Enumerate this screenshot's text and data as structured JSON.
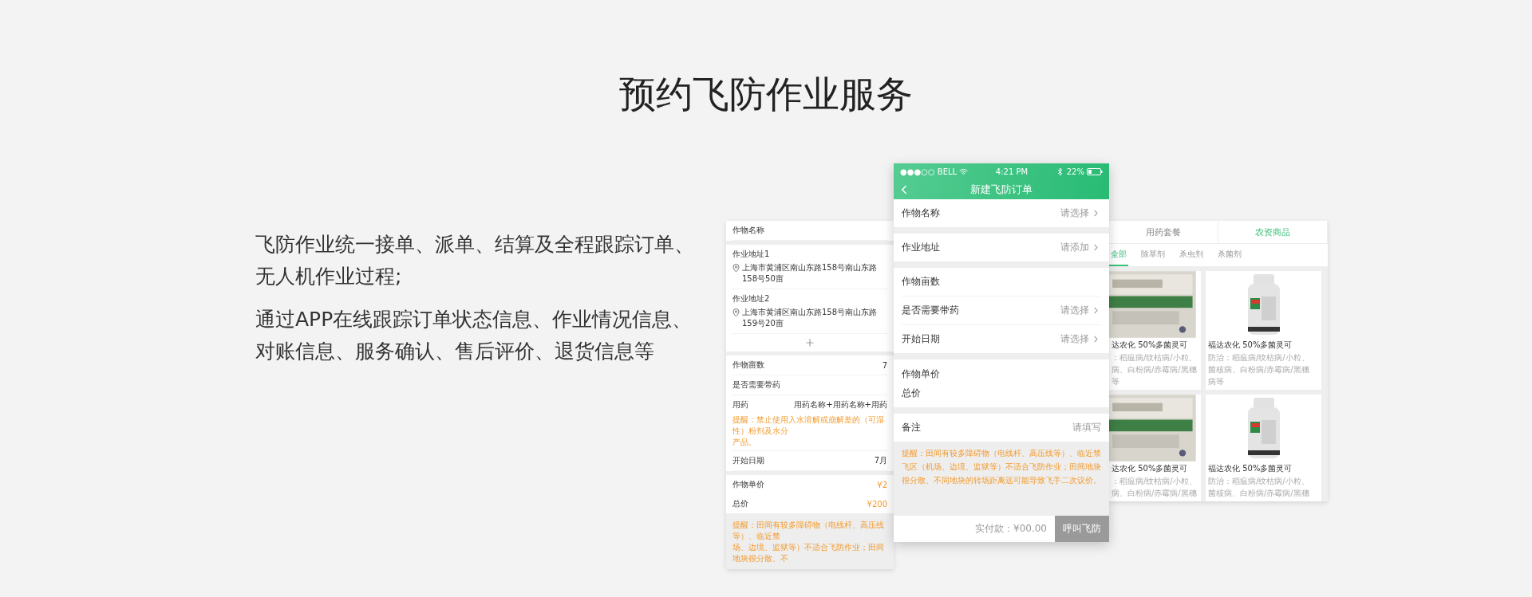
{
  "title": "预约飞防作业服务",
  "intro": [
    "飞防作业统一接单、派单、结算及全程跟踪订单、无人机作业过程;",
    "通过APP在线跟踪订单状态信息、作业情况信息、对账信息、服务确认、售后评价、退货信息等"
  ],
  "order_card": {
    "crop_label": "作物名称",
    "addresses": [
      {
        "label": "作业地址1",
        "address": "上海市黄浦区南山东路158号南山东路158号50亩"
      },
      {
        "label": "作业地址2",
        "address": "上海市黄浦区南山东路158号南山东路159号20亩"
      }
    ],
    "rows": [
      {
        "kind": "value",
        "label": "作物亩数",
        "value": "7"
      },
      {
        "kind": "value",
        "label": "是否需要带药"
      },
      {
        "kind": "drug",
        "label": "用药",
        "value": "用药名称+用药名称+用药",
        "note_lines": [
          "提醒：禁止使用入水溶解或崩解差的（可湿性）粉剂及水分",
          "产品。"
        ]
      },
      {
        "kind": "value",
        "label": "开始日期",
        "value": "7月"
      }
    ],
    "prices": [
      {
        "label": "作物单价",
        "value": "¥2"
      },
      {
        "label": "总价",
        "value": "¥200"
      }
    ],
    "note_lines": [
      "提醒：田间有较多障碍物（电线杆、高压线等）、临近禁",
      "场、边境、监狱等）不适合飞防作业；田间地块很分散、不"
    ]
  },
  "phone": {
    "status_bar": {
      "carrier": "●●●○○ BELL",
      "time": "4:21 PM",
      "battery": "22%"
    },
    "nav_title": "新建飞防订单",
    "groups": [
      [
        {
          "kind": "select",
          "label": "作物名称",
          "action": "请选择"
        }
      ],
      [
        {
          "kind": "select",
          "label": "作业地址",
          "action": "请添加"
        }
      ],
      [
        {
          "kind": "plain",
          "label": "作物亩数"
        },
        {
          "kind": "select",
          "label": "是否需要带药",
          "action": "请选择"
        },
        {
          "kind": "select",
          "label": "开始日期",
          "action": "请选择"
        }
      ],
      [
        {
          "kind": "compact",
          "label": "作物单价"
        },
        {
          "kind": "compact",
          "label": "总价"
        }
      ],
      [
        {
          "kind": "input",
          "label": "备注",
          "action": "请填写"
        }
      ]
    ],
    "note": "提醒：田间有较多障碍物（电线杆、高压线等）、临近禁飞区（机场、边境、监狱等）不适合飞防作业；田间地块很分散、不同地块的转场距离远可能导致飞手二次议价。",
    "total": "实付款：¥00.00",
    "call_button": "呼叫飞防"
  },
  "shop_card": {
    "tabs": [
      {
        "label": "用药套餐",
        "selected": false
      },
      {
        "label": "农资商品",
        "selected": true
      }
    ],
    "filters": [
      {
        "label": "全部",
        "selected": true
      },
      {
        "label": "除草剂",
        "selected": false
      },
      {
        "label": "杀虫剂",
        "selected": false
      },
      {
        "label": "杀菌剂",
        "selected": false
      }
    ],
    "products": [
      {
        "name": "达农化 50%多菌灵可",
        "desc_lines": [
          "：稻瘟病/纹枯病/小粒、",
          "病、白粉病/赤霉病/黑穗",
          "等"
        ]
      },
      {
        "name": "福达农化 50%多菌灵可",
        "desc_lines": [
          "防治：稻瘟病/纹枯病/小粒、",
          "菌核病、白粉病/赤霉病/黑穗",
          "病等"
        ]
      },
      {
        "name": "达农化 50%多菌灵可",
        "desc_lines": [
          "：稻瘟病/纹枯病/小粒、",
          "病、白粉病/赤霉病/黑穗"
        ]
      },
      {
        "name": "福达农化 50%多菌灵可",
        "desc_lines": [
          "防治：稻瘟病/纹枯病/小粒、",
          "菌核病、白粉病/赤霉病/黑穗"
        ]
      }
    ]
  }
}
